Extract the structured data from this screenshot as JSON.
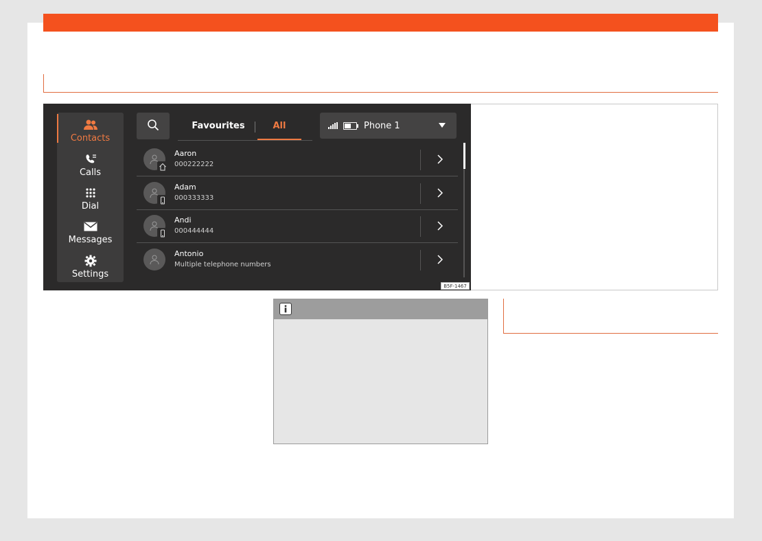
{
  "colors": {
    "accent": "#f4511e",
    "active": "#f07a42",
    "screen_bg": "#2b2a2a"
  },
  "sidebar": {
    "items": [
      {
        "label": "Contacts",
        "icon": "contacts-icon",
        "active": true
      },
      {
        "label": "Calls",
        "icon": "calls-icon",
        "active": false
      },
      {
        "label": "Dial",
        "icon": "dial-pad-icon",
        "active": false
      },
      {
        "label": "Messages",
        "icon": "envelope-icon",
        "active": false
      },
      {
        "label": "Settings",
        "icon": "gear-icon",
        "active": false
      }
    ]
  },
  "header": {
    "tabs": [
      {
        "label": "Favourites",
        "active": false
      },
      {
        "label": "All",
        "active": true
      }
    ],
    "phone": {
      "name": "Phone 1"
    }
  },
  "contacts": [
    {
      "name": "Aaron",
      "detail": "000222222",
      "badge": "home-icon"
    },
    {
      "name": "Adam",
      "detail": "000333333",
      "badge": "mobile-icon"
    },
    {
      "name": "Andi",
      "detail": "000444444",
      "badge": "mobile-icon"
    },
    {
      "name": "Antonio",
      "detail": "Multiple telephone numbers",
      "badge": ""
    }
  ],
  "figure": {
    "code": "B5F-1467"
  }
}
